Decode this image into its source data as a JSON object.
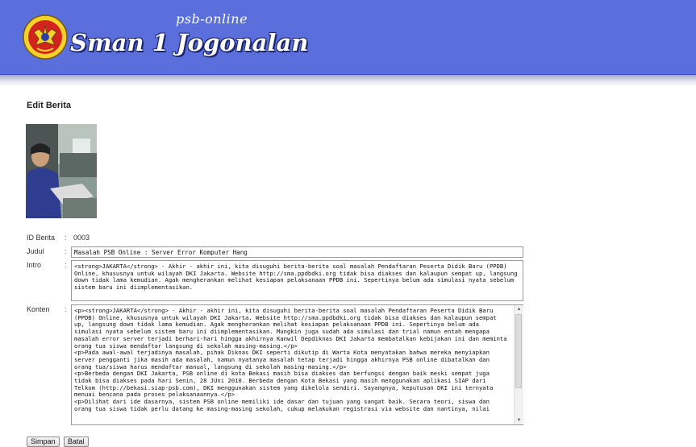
{
  "header": {
    "subtitle": "psb-online",
    "title": "Sman 1 Jogonalan"
  },
  "page": {
    "title": "Edit Berita"
  },
  "form": {
    "id_label": "ID Berita",
    "id_value": "0003",
    "judul_label": "Judul",
    "judul_value": "Masalah PSB Online : Server Error Komputer Hang",
    "intro_label": "Intro",
    "intro_value": "<strong>JAKARTA</strong> - Akhir - akhir ini, kita disuguhi berita-berita soal masalah Pendaftaran Peserta Didik Baru (PPDB) Online, khususnya untuk wilayah DKI Jakarta. Website http://sma.ppdbdki.org tidak bisa diakses dan kalaupun sempat up, langsung down tidak lama kemudian. Agak mengherankan melihat kesiapan pelaksanaan PPDB ini. Sepertinya belum ada simulasi nyata sebelum sistem baru ini diimplementasikan.",
    "konten_label": "Konten",
    "konten_value": "<p><strong>JAKARTA</strong> - Akhir - akhir ini, kita disuguhi berita-berita soal masalah Pendaftaran Peserta Didik Baru (PPDB) Online, khususnya untuk wilayah DKI Jakarta. Website http://sma.ppdbdki.org tidak bisa diakses dan kalaupun sempat up, langsung down tidak lama kemudian. Agak mengherankan melihat kesiapan pelaksanaan PPDB ini. Sepertinya belum ada simulasi nyata sebelum sistem baru ini diimplementasikan. Mungkin juga sudah ada simulasi dan trial namun entah mengapa masalah error server terjadi berhari-hari hingga akhirnya Kanwil Depdiknas DKI Jakarta membatalkan kebijakan ini dan meminta orang tua siswa mendaftar langsung di sekolah masing-masing.</p>\n<p>Pada awal-awal terjadinya masalah, pihak Diknas DKI seperti dikutip di Warta Kota menyatakan bahwa mereka menyiapkan server pengganti jika masih ada masalah, namun nyatanya masalah tetap terjadi hingga akhirnya PSB online dibatalkan dan orang tua/siswa harus mendaftar manual, langsung di sekolah masing-masing.</p>\n<p>Berbeda dengan DKI Jakarta, PSB online di kota Bekasi masih bisa diakses dan berfungsi dengan baik meski sempat juga tidak bisa diakses pada hari Senin, 28 JUni 2010. Berbeda dengan Kota Bekasi yang masih menggunakan aplikasi SIAP dari Telkom (http://bekasi.siap-psb.com), DKI menggunakan sistem yang dikelola sendiri. Sayangnya, keputusan DKI ini ternyata menuai bencana pada proses pelaksanaannya.</p>\n<p>Dilihat dari ide dasarnya, sistem PSB online memiliki ide dasar dan tujuan yang sangat baik. Secara teori, siswa dan orang tua siswa tidak perlu datang ke masing-masing sekolah, cukup melakukan registrasi via website dan nantinya, nilai"
  },
  "buttons": {
    "save": "Simpan",
    "cancel": "Batal"
  }
}
